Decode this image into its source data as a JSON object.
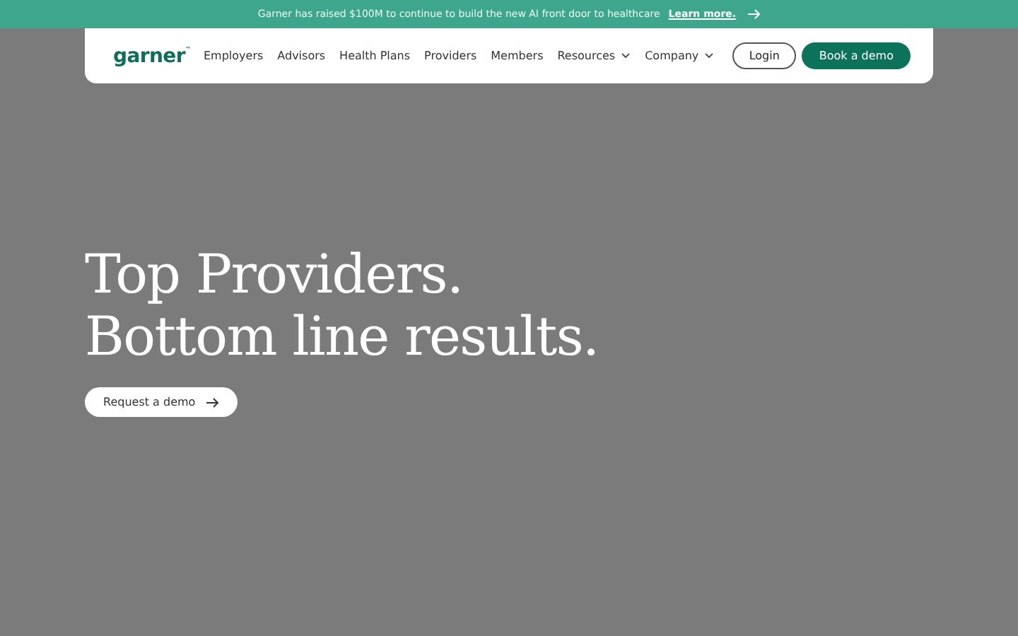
{
  "announcement": {
    "text": "Garner has raised $100M to continue to build the new AI front door to healthcare",
    "link": "Learn more."
  },
  "nav": {
    "logo": "garner$^{™}$",
    "items": [
      {
        "label": "Employers",
        "kind": "link"
      },
      {
        "label": "Advisors",
        "kind": "link"
      },
      {
        "label": "Health Plans",
        "kind": "link"
      },
      {
        "label": "Providers",
        "kind": "link"
      },
      {
        "label": "Members",
        "kind": "link"
      },
      {
        "label": "Resources",
        "kind": "dropdown"
      },
      {
        "label": "Company",
        "kind": "dropdown"
      }
    ],
    "login": "Login",
    "cta": "Book a demo"
  },
  "hero": {
    "title_lines": [
      "Top Providers.",
      "Bottom line results."
    ],
    "button": "Request a demo"
  }
}
